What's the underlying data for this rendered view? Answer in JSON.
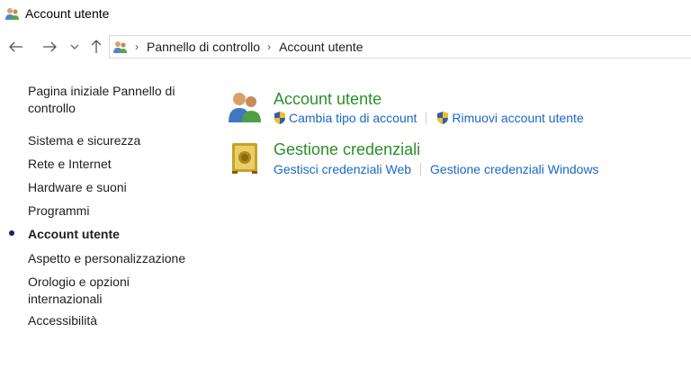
{
  "window": {
    "title": "Account utente"
  },
  "breadcrumb": [
    "Pannello di controllo",
    "Account utente"
  ],
  "sidebar": {
    "items": [
      {
        "label": "Pagina iniziale Pannello di controllo",
        "line1": "Pagina iniziale Pannello di",
        "line2": "controllo"
      },
      {
        "label": "Sistema e sicurezza"
      },
      {
        "label": "Rete e Internet"
      },
      {
        "label": "Hardware e suoni"
      },
      {
        "label": "Programmi"
      },
      {
        "label": "Account utente",
        "current": true
      },
      {
        "label": "Aspetto e personalizzazione"
      },
      {
        "label": "Orologio e opzioni internazionali",
        "line1": "Orologio e opzioni",
        "line2": "internazionali"
      },
      {
        "label": "Accessibilità"
      }
    ]
  },
  "categories": [
    {
      "title": "Account utente",
      "icon": "user-accounts-icon",
      "links": [
        {
          "label": "Cambia tipo di account",
          "icon": "uac-shield-icon"
        },
        {
          "label": "Rimuovi account utente",
          "icon": "uac-shield-icon"
        }
      ]
    },
    {
      "title": "Gestione credenziali",
      "icon": "credential-vault-icon",
      "links": [
        {
          "label": "Gestisci credenziali Web"
        },
        {
          "label": "Gestione credenziali Windows"
        }
      ]
    }
  ],
  "colors": {
    "category_title": "#2b8f2b",
    "link": "#1a67c6",
    "bullet": "#1b1b6f"
  }
}
